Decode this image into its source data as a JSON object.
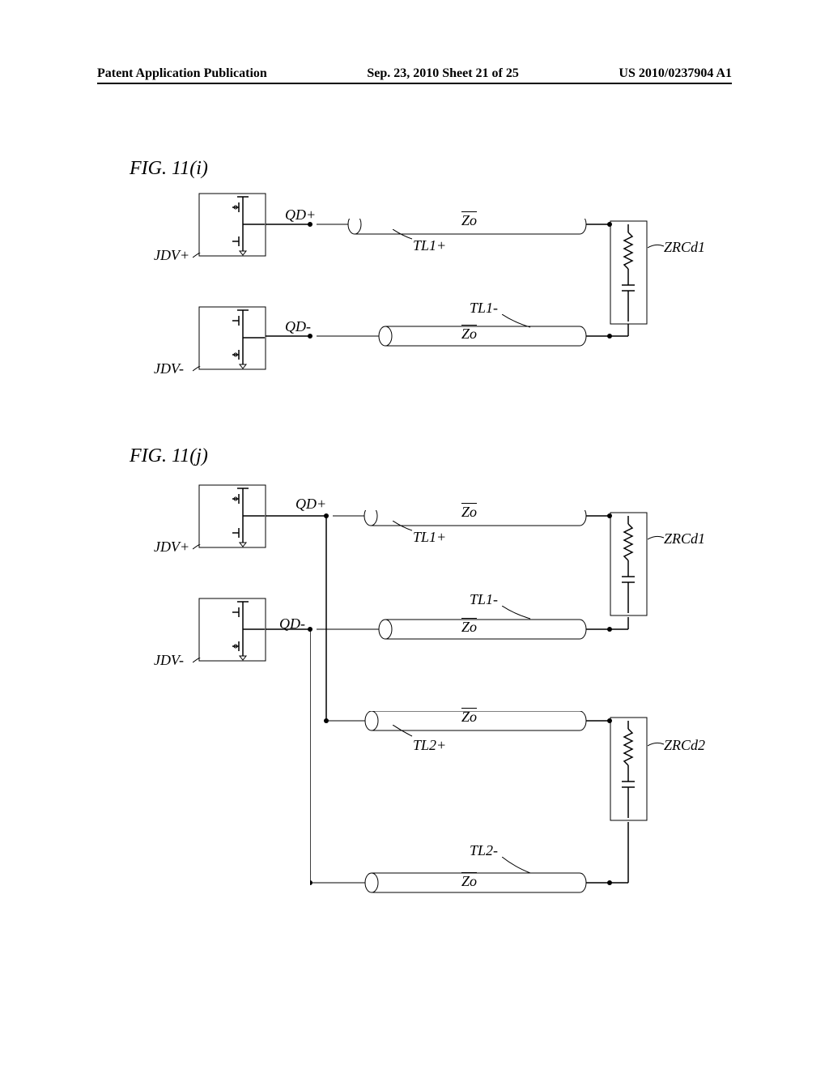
{
  "header": {
    "left": "Patent Application Publication",
    "center": "Sep. 23, 2010  Sheet 21 of 25",
    "right": "US 2010/0237904 A1"
  },
  "fig_i": {
    "label": "FIG. 11(i)",
    "jdv_plus": "JDV+",
    "jdv_minus": "JDV-",
    "qd_plus": "QD+",
    "qd_minus": "QD-",
    "zo": "Zo",
    "tl1_plus": "TL1+",
    "tl1_minus": "TL1-",
    "zrcd1": "ZRCd1"
  },
  "fig_j": {
    "label": "FIG. 11(j)",
    "jdv_plus": "JDV+",
    "jdv_minus": "JDV-",
    "qd_plus": "QD+",
    "qd_minus": "QD-",
    "zo": "Zo",
    "tl1_plus": "TL1+",
    "tl1_minus": "TL1-",
    "tl2_plus": "TL2+",
    "tl2_minus": "TL2-",
    "zrcd1": "ZRCd1",
    "zrcd2": "ZRCd2"
  }
}
